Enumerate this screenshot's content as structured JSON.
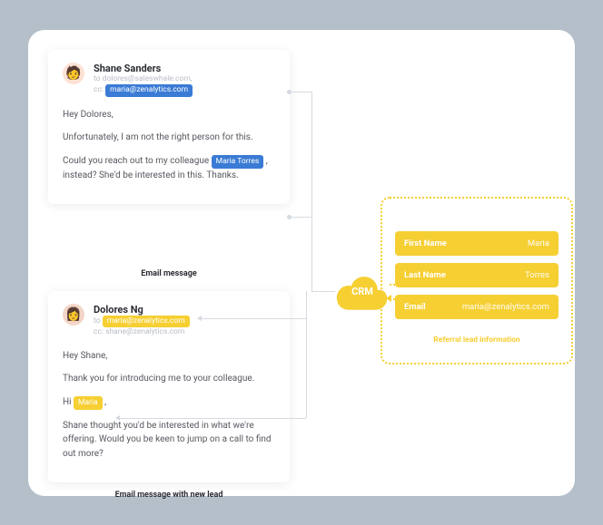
{
  "email1": {
    "sender": "Shane Sanders",
    "to_line": "to dolores@saleswhale.com,",
    "cc_prefix": "cc: ",
    "cc_email": "maria@zenalytics.com",
    "greeting": "Hey Dolores,",
    "p1": "Unfortunately, I am not the right person for this.",
    "p2a": "Could you reach out to my colleague ",
    "highlight": "Maria Torres",
    "p2b": " , instead? She'd be interested in this. Thanks.",
    "caption": "Email message"
  },
  "email2": {
    "sender": "Dolores Ng",
    "to_prefix": "to ",
    "to_email": "maria@zenalytics.com",
    "cc_line": "cc: shane@zenalytics.com",
    "greeting": "Hey Shane,",
    "p1": "Thank you for introducing me to your colleague.",
    "p2a": "Hi ",
    "highlight": "Maria",
    "p2b": " ,",
    "p3": "Shane thought you'd be interested in what we're offering. Would you be keen to jump on a call to find out more?",
    "caption": "Email message with new lead"
  },
  "crm": {
    "label": "CRM",
    "rows": [
      {
        "key": "First Name",
        "value": "Maria"
      },
      {
        "key": "Last Name",
        "value": "Torres"
      },
      {
        "key": "Email",
        "value": "maria@zenalytics.com"
      }
    ],
    "caption": "Referral lead information"
  },
  "colors": {
    "accent_blue": "#3a7bd5",
    "accent_yellow": "#f6cf33"
  }
}
